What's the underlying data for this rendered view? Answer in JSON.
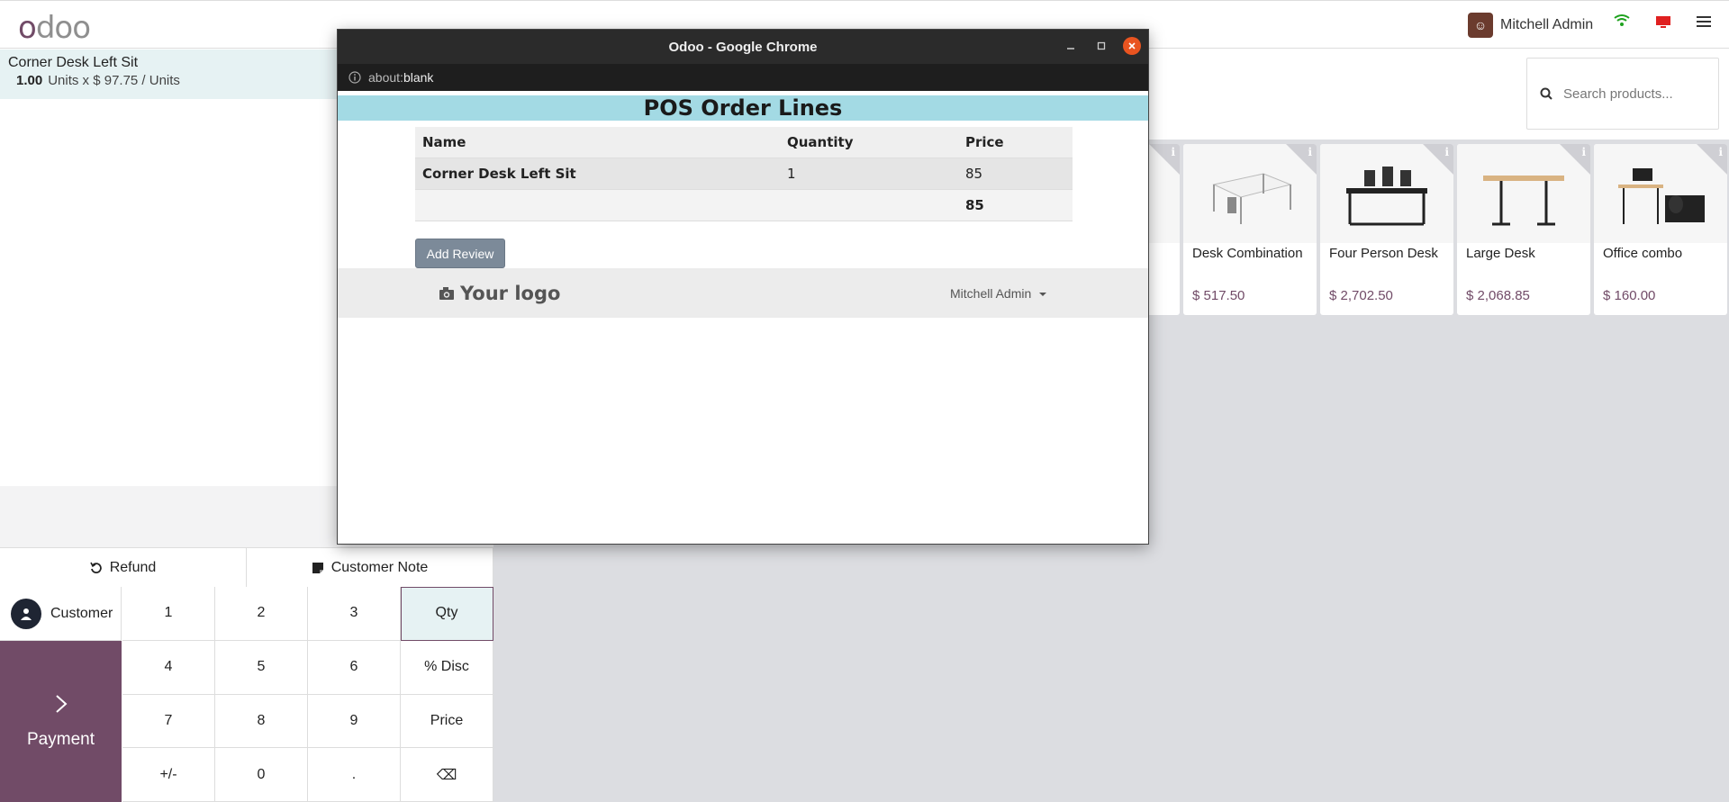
{
  "topbar": {
    "logo": "odoo",
    "user_name": "Mitchell Admin"
  },
  "order": {
    "line_name": "Corner Desk Left Sit",
    "line_qty": "1.00",
    "line_detail": "Units x $ 97.75 / Units"
  },
  "controls": {
    "refund": "Refund",
    "customer_note": "Customer Note",
    "customer": "Customer",
    "payment": "Payment"
  },
  "keypad": [
    "1",
    "2",
    "3",
    "Qty",
    "4",
    "5",
    "6",
    "% Disc",
    "7",
    "8",
    "9",
    "Price",
    "+/-",
    "0",
    ".",
    "⌫"
  ],
  "search": {
    "placeholder": "Search products..."
  },
  "products": [
    {
      "name": "Desk Combination",
      "price": "$ 517.50"
    },
    {
      "name": "Four Person Desk",
      "price": "$ 2,702.50"
    },
    {
      "name": "Large Desk",
      "price": "$ 2,068.85"
    },
    {
      "name": "Office combo",
      "price": "$ 160.00"
    }
  ],
  "popup": {
    "window_title": "Odoo - Google Chrome",
    "address_prefix": "about:",
    "address_blank": "blank",
    "header": "POS Order Lines",
    "columns": [
      "Name",
      "Quantity",
      "Price"
    ],
    "row": {
      "name": "Corner Desk Left Sit",
      "qty": "1",
      "price": "85"
    },
    "total": "85",
    "add_review": "Add Review",
    "logo_text": "Your logo",
    "footer_user": "Mitchell Admin"
  },
  "colors": {
    "brand": "#714b67",
    "header_band": "#a3dae4",
    "close_button": "#e95420"
  }
}
